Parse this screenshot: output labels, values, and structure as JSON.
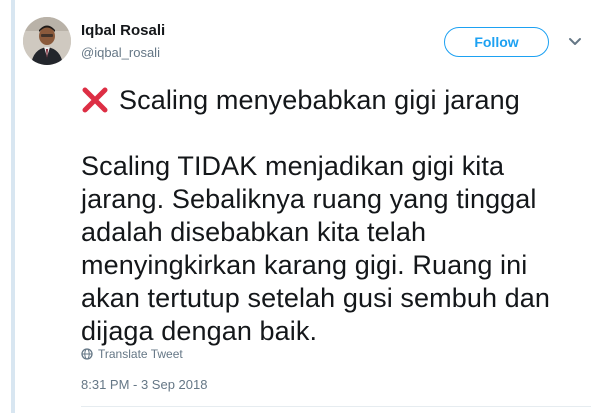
{
  "author": {
    "display_name": "Iqbal Rosali",
    "handle": "@iqbal_rosali",
    "avatar_icon": "profile-photo"
  },
  "actions": {
    "follow_label": "Follow",
    "more_icon": "chevron-down-icon"
  },
  "tweet": {
    "headline_icon": "red-cross-mark",
    "headline": "Scaling menyebabkan gigi jarang",
    "body": "Scaling TIDAK menjadikan gigi kita\njarang. Sebaliknya ruang yang tinggal\nadalah disebabkan kita telah\nmenyingkirkan karang gigi. Ruang ini\nakan tertutup setelah gusi sembuh dan\ndijaga dengan baik.",
    "translate_label": "Translate Tweet",
    "timestamp": "8:31 PM - 3 Sep 2018"
  },
  "colors": {
    "accent": "#1da1f2",
    "secondary_text": "#657786",
    "cross_red": "#dd2e44",
    "thread_line": "#d8e6f1"
  }
}
